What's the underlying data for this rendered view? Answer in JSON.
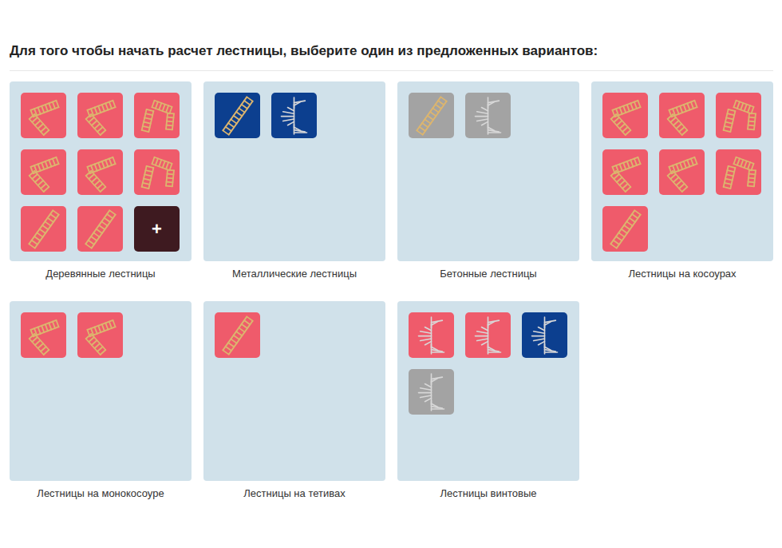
{
  "heading": "Для того чтобы начать расчет лестницы, выберите один из предложенных вариантов:",
  "categories": [
    {
      "label": "Деревянные лестницы",
      "items": [
        {
          "kind": "l-turn",
          "color": "#ef5b6b"
        },
        {
          "kind": "l-turn",
          "color": "#ef5b6b"
        },
        {
          "kind": "u-turn",
          "color": "#ef5b6b"
        },
        {
          "kind": "l-turn",
          "color": "#ef5b6b"
        },
        {
          "kind": "l-turn",
          "color": "#ef5b6b"
        },
        {
          "kind": "u-turn",
          "color": "#ef5b6b"
        },
        {
          "kind": "straight",
          "color": "#ef5b6b"
        },
        {
          "kind": "straight",
          "color": "#ef5b6b"
        },
        {
          "kind": "add",
          "color": "#3e1a20",
          "label": "+"
        }
      ]
    },
    {
      "label": "Металлические лестницы",
      "items": [
        {
          "kind": "straight",
          "color": "#0c3f8f"
        },
        {
          "kind": "spiral",
          "color": "#0c3f8f"
        }
      ]
    },
    {
      "label": "Бетонные лестницы",
      "items": [
        {
          "kind": "straight",
          "color": "#a3a3a3"
        },
        {
          "kind": "spiral",
          "color": "#a3a3a3"
        }
      ]
    },
    {
      "label": "Лестницы на косоурах",
      "items": [
        {
          "kind": "l-turn",
          "color": "#ef5b6b"
        },
        {
          "kind": "l-turn",
          "color": "#ef5b6b"
        },
        {
          "kind": "u-turn",
          "color": "#ef5b6b"
        },
        {
          "kind": "l-turn",
          "color": "#ef5b6b"
        },
        {
          "kind": "l-turn",
          "color": "#ef5b6b"
        },
        {
          "kind": "u-turn",
          "color": "#ef5b6b"
        },
        {
          "kind": "straight",
          "color": "#ef5b6b"
        }
      ]
    },
    {
      "label": "Лестницы на монокосоуре",
      "items": [
        {
          "kind": "l-turn",
          "color": "#ef5b6b"
        },
        {
          "kind": "l-turn",
          "color": "#ef5b6b"
        }
      ]
    },
    {
      "label": "Лестницы на тетивах",
      "items": [
        {
          "kind": "straight",
          "color": "#ef5b6b"
        }
      ]
    },
    {
      "label": "Лестницы винтовые",
      "items": [
        {
          "kind": "spiral",
          "color": "#ef5b6b"
        },
        {
          "kind": "spiral",
          "color": "#ef5b6b"
        },
        {
          "kind": "spiral",
          "color": "#0c3f8f"
        },
        {
          "kind": "spiral",
          "color": "#a3a3a3"
        }
      ]
    }
  ]
}
